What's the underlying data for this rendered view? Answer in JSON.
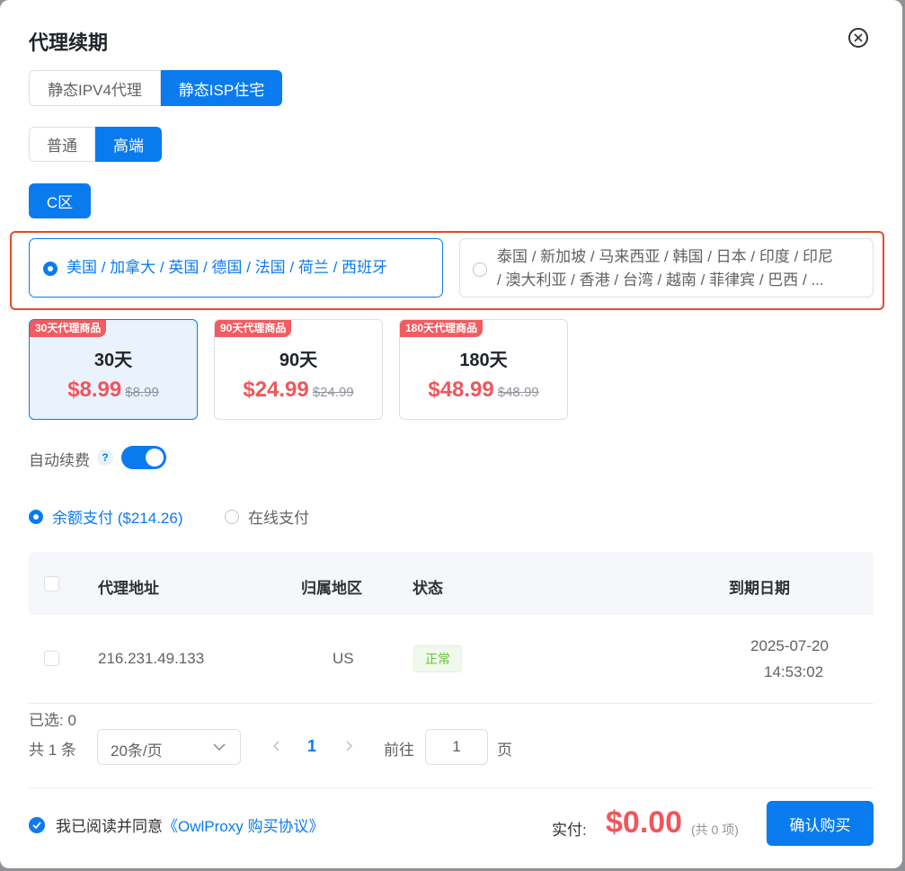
{
  "dialog": {
    "title": "代理续期"
  },
  "proxy_type_tabs": [
    {
      "label": "静态IPV4代理",
      "active": false
    },
    {
      "label": "静态ISP住宅",
      "active": true
    }
  ],
  "tier_tabs": [
    {
      "label": "普通",
      "active": false
    },
    {
      "label": "高端",
      "active": true
    }
  ],
  "zone": {
    "label": "C区"
  },
  "regions": [
    {
      "label": "美国 / 加拿大 / 英国 / 德国 / 法国 / 荷兰 / 西班牙",
      "selected": true
    },
    {
      "label_line1": "泰国 / 新加坡 / 马来西亚 / 韩国 / 日本 / 印度 / 印尼",
      "label_line2": "/ 澳大利亚 / 香港 / 台湾 / 越南 / 菲律宾 / 巴西 / ...",
      "selected": false
    }
  ],
  "plans": [
    {
      "tag": "30天代理商品",
      "days": "30天",
      "price": "$8.99",
      "original": "$8.99",
      "selected": true
    },
    {
      "tag": "90天代理商品",
      "days": "90天",
      "price": "$24.99",
      "original": "$24.99",
      "selected": false
    },
    {
      "tag": "180天代理商品",
      "days": "180天",
      "price": "$48.99",
      "original": "$48.99",
      "selected": false
    }
  ],
  "auto_renew": {
    "label": "自动续费",
    "help": "?",
    "enabled": true
  },
  "payment": [
    {
      "label": "余额支付 ($214.26)",
      "selected": true
    },
    {
      "label": "在线支付",
      "selected": false
    }
  ],
  "table": {
    "headers": {
      "address": "代理地址",
      "region": "归属地区",
      "status": "状态",
      "expiry": "到期日期"
    },
    "rows": [
      {
        "address": "216.231.49.133",
        "region": "US",
        "status": "正常",
        "expiry_date": "2025-07-20",
        "expiry_time": "14:53:02"
      }
    ]
  },
  "selection": {
    "label": "已选: 0"
  },
  "pagination": {
    "total": "共 1 条",
    "page_size": "20条/页",
    "current_page": "1",
    "goto_label": "前往",
    "goto_value": "1",
    "page_unit": "页"
  },
  "footer": {
    "agree_text": "我已阅读并同意",
    "agree_link": "《OwlProxy 购买协议》",
    "pay_label": "实付:",
    "pay_amount": "$0.00",
    "pay_count": "(共 0 项)",
    "confirm_label": "确认购买"
  },
  "colors": {
    "primary": "#0a7bef",
    "price": "#f0565c",
    "highlight_border": "#e8492b",
    "status_green": "#67c23a"
  }
}
